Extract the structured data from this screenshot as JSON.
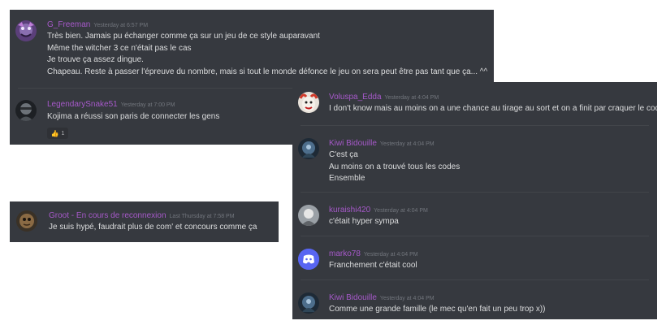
{
  "panel_a": {
    "msg1": {
      "username": "G_Freeman",
      "timestamp": "Yesterday at 6:57 PM",
      "lines": [
        "Très bien. Jamais pu échanger comme ça sur un jeu de ce style auparavant",
        "Même the witcher 3 ce n'était pas le cas",
        "Je trouve ça assez dingue.",
        "Chapeau. Reste à passer l'épreuve du nombre, mais si tout le monde défonce le jeu on sera peut être pas tant que ça... ^^"
      ]
    },
    "msg2": {
      "username": "LegendarySnake51",
      "timestamp": "Yesterday at 7:00 PM",
      "lines": [
        "Kojima a réussi son paris de connecter les gens"
      ],
      "reaction": {
        "icon": "thumbs-up-icon",
        "count": "1"
      }
    }
  },
  "panel_b": {
    "msg1": {
      "username": "Groot - En cours de reconnexion",
      "timestamp": "Last Thursday at 7:58 PM",
      "lines": [
        "Je suis hypé, faudrait plus de com' et concours comme ça"
      ]
    }
  },
  "panel_c": {
    "messages": [
      {
        "username": "Voluspa_Edda",
        "timestamp": "Yesterday at 4:04 PM",
        "lines": [
          "I don't know mais au moins on a une chance au tirage au sort et on a finit par craquer le code !"
        ]
      },
      {
        "username": "Kiwi Bidouille",
        "timestamp": "Yesterday at 4:04 PM",
        "lines": [
          "C'est ça",
          "Au moins on a trouvé tous les codes",
          "Ensemble"
        ]
      },
      {
        "username": "kuraishi420",
        "timestamp": "Yesterday at 4:04 PM",
        "lines": [
          "c'était hyper sympa"
        ]
      },
      {
        "username": "marko78",
        "timestamp": "Yesterday at 4:04 PM",
        "lines": [
          "Franchement c'était cool"
        ]
      },
      {
        "username": "Kiwi Bidouille",
        "timestamp": "Yesterday at 4:04 PM",
        "lines": [
          "Comme une grande famille (le mec qu'en fait un peu trop x))"
        ]
      }
    ]
  },
  "colors": {
    "background": "#36393f",
    "username": "#a659c9",
    "timestamp": "#72767d",
    "text": "#dcddde",
    "discord_blurple": "#5865f2"
  }
}
